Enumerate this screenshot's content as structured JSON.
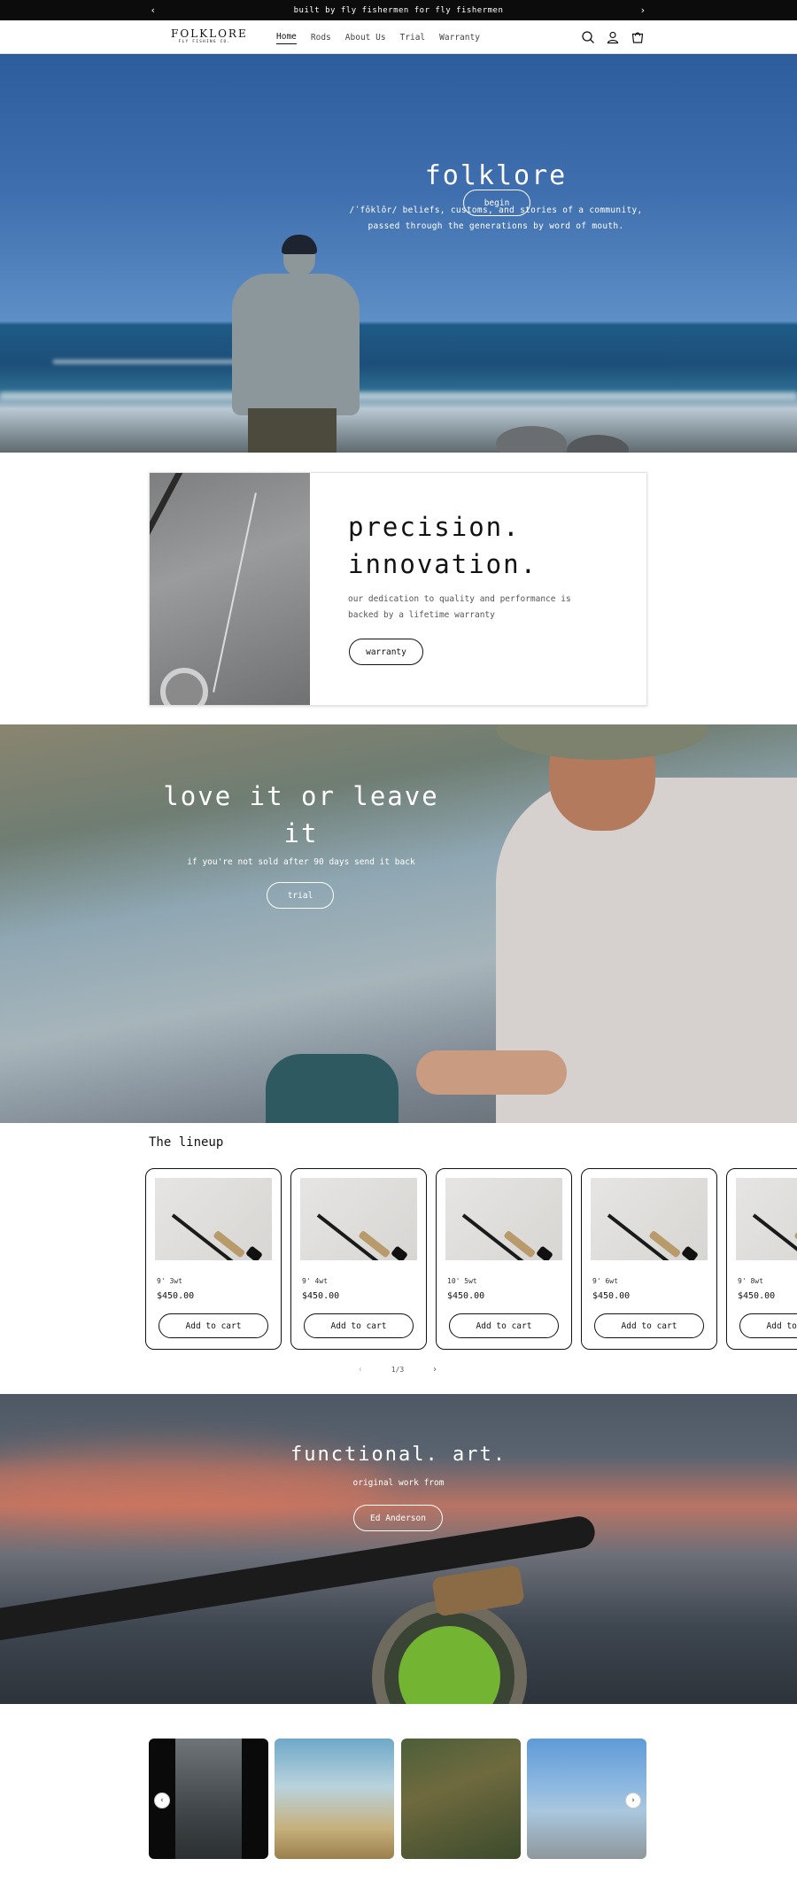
{
  "announcement": {
    "text": "built by fly fishermen for fly fishermen",
    "prev": "‹",
    "next": "›"
  },
  "header": {
    "logo": {
      "main": "FOLKLORE",
      "sub": "FLY FISHING CO."
    },
    "nav": [
      "Home",
      "Rods",
      "About Us",
      "Trial",
      "Warranty"
    ],
    "active": "Home",
    "icons": [
      "search-icon",
      "account-icon",
      "cart-icon"
    ]
  },
  "hero": {
    "title": "folklore",
    "subtitle_line1": "/ˈfōklôr/ beliefs, customs, and stories of a community,",
    "subtitle_line2": "passed through the generations by word of mouth.",
    "button": "begin"
  },
  "precision": {
    "title_line1": "precision.",
    "title_line2": "innovation.",
    "text": "our dedication to quality and performance is backed by a lifetime warranty",
    "button": "warranty"
  },
  "trial": {
    "title": "love it or leave it",
    "text": "if you're not sold after 90 days send it back",
    "button": "trial"
  },
  "lineup": {
    "title": "The lineup",
    "products": [
      {
        "name": "9' 3wt",
        "price": "$450.00",
        "button": "Add to cart"
      },
      {
        "name": "9' 4wt",
        "price": "$450.00",
        "button": "Add to cart"
      },
      {
        "name": "10' 5wt",
        "price": "$450.00",
        "button": "Add to cart"
      },
      {
        "name": "9' 6wt",
        "price": "$450.00",
        "button": "Add to cart"
      },
      {
        "name": "9' 8wt",
        "price": "$450.00",
        "button": "Add to cart"
      }
    ],
    "pager": {
      "text": "1/3",
      "prev": "‹",
      "next": "›"
    }
  },
  "art": {
    "title": "functional. art.",
    "text": "original work from",
    "button": "Ed Anderson"
  },
  "gallery": {
    "prev": "‹",
    "next": "›"
  },
  "colors": {
    "announcement_bg": "#0c0c0c",
    "text": "#121212",
    "white": "#ffffff"
  }
}
